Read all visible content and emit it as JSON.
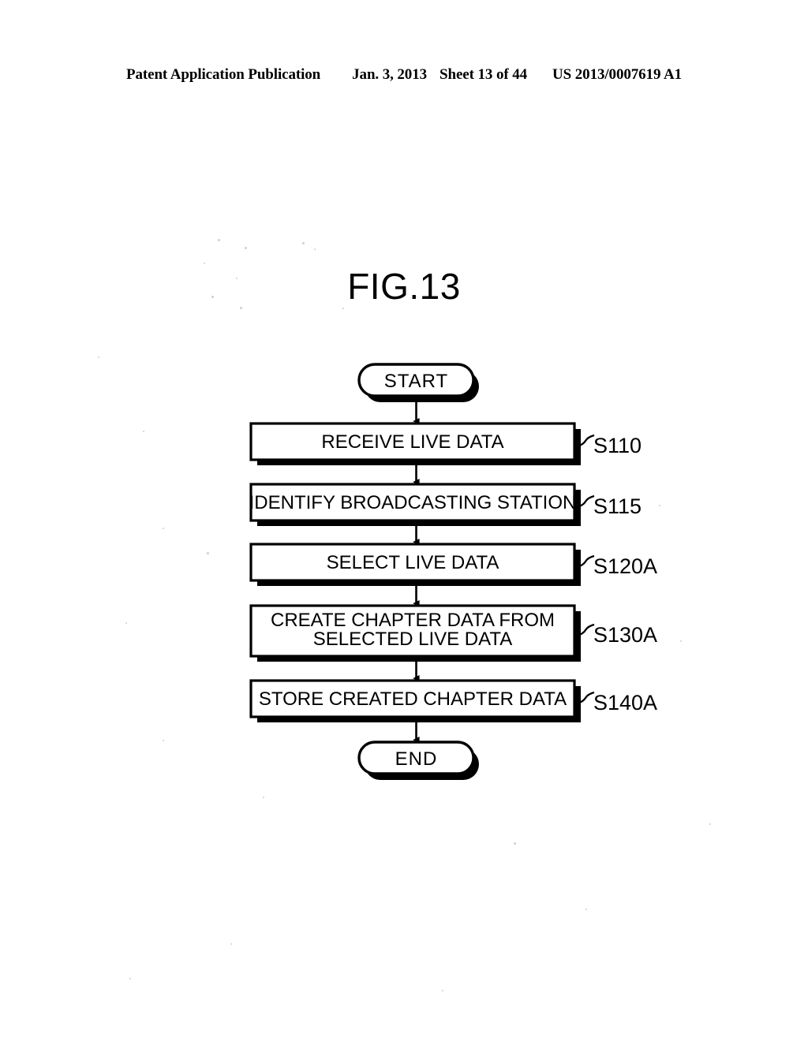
{
  "header": {
    "publication": "Patent Application Publication",
    "date": "Jan. 3, 2013",
    "sheet": "Sheet 13 of 44",
    "document_number": "US 2013/0007619 A1"
  },
  "figure": {
    "title": "FIG.13"
  },
  "flowchart": {
    "type": "flowchart",
    "orientation": "vertical",
    "start_label": "START",
    "end_label": "END",
    "steps": [
      {
        "id": "S110",
        "text": "RECEIVE LIVE DATA",
        "lines": [
          "RECEIVE LIVE DATA"
        ]
      },
      {
        "id": "S115",
        "text": "IDENTIFY BROADCASTING STATION",
        "lines": [
          "IDENTIFY BROADCASTING STATION"
        ]
      },
      {
        "id": "S120A",
        "text": "SELECT LIVE DATA",
        "lines": [
          "SELECT LIVE DATA"
        ]
      },
      {
        "id": "S130A",
        "text": "CREATE CHAPTER DATA FROM SELECTED LIVE DATA",
        "lines": [
          "CREATE CHAPTER DATA FROM",
          "SELECTED LIVE DATA"
        ]
      },
      {
        "id": "S140A",
        "text": "STORE CREATED CHAPTER DATA",
        "lines": [
          "STORE CREATED CHAPTER DATA"
        ]
      }
    ],
    "colors": {
      "stroke": "#000000",
      "fill": "#ffffff",
      "shadow": "#000000",
      "background": "#ffffff"
    }
  }
}
